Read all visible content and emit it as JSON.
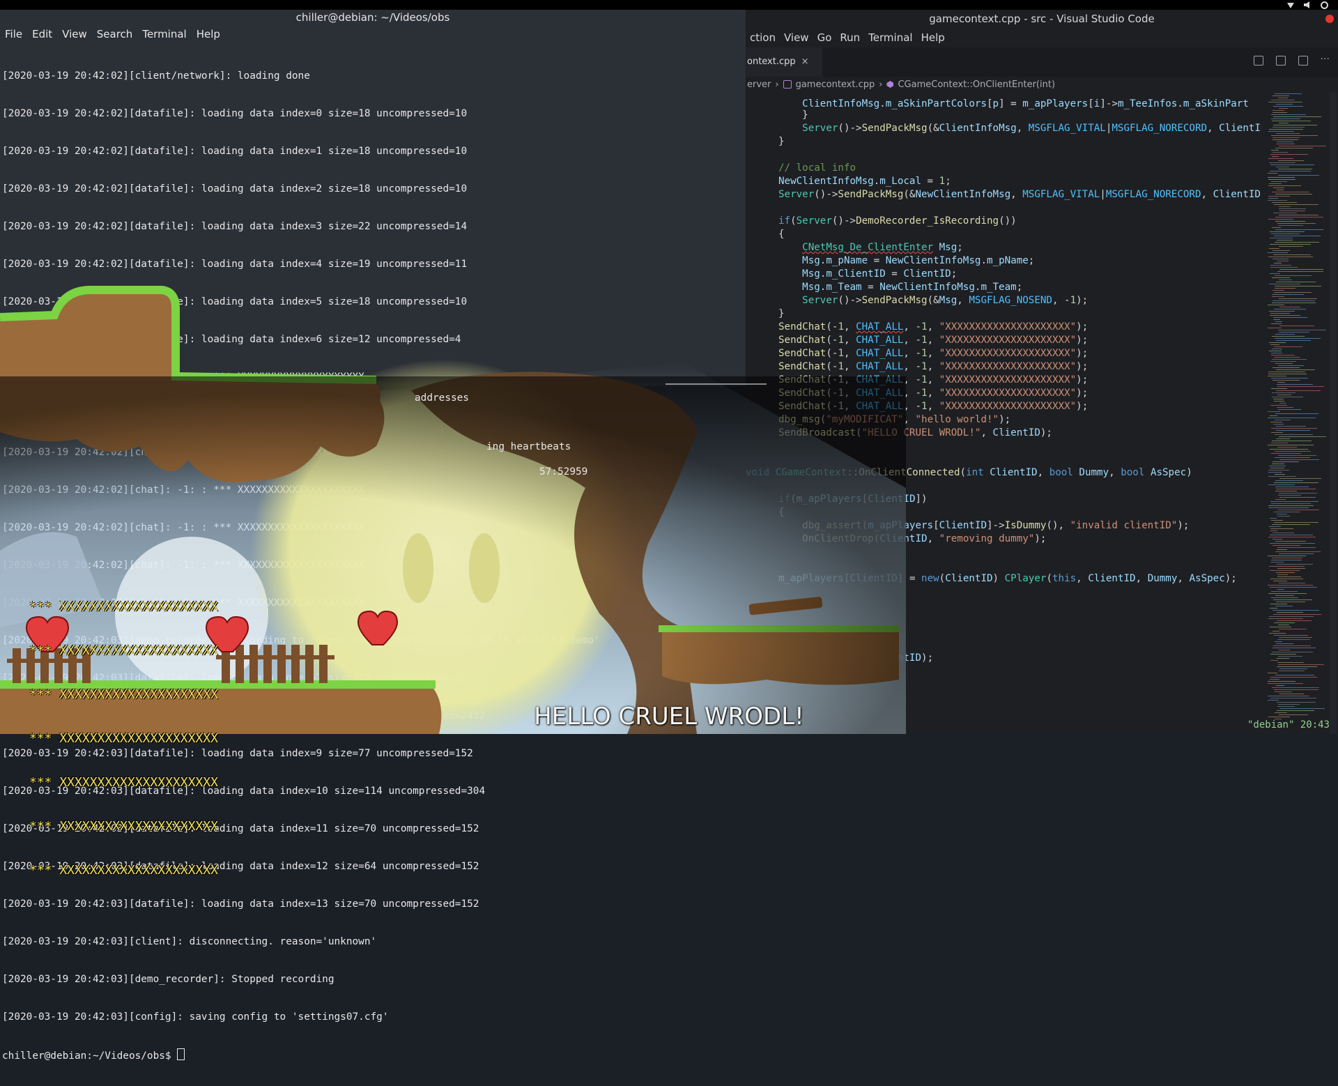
{
  "topbar": {
    "icons": [
      "wifi-icon",
      "volume-icon",
      "power-icon"
    ]
  },
  "terminal": {
    "title": "chiller@debian: ~/Videos/obs",
    "menu": [
      "File",
      "Edit",
      "View",
      "Search",
      "Terminal",
      "Help"
    ],
    "lines": [
      "[2020-03-19 20:42:02][client/network]: loading done",
      "[2020-03-19 20:42:02][datafile]: loading data index=0 size=18 uncompressed=10",
      "[2020-03-19 20:42:02][datafile]: loading data index=1 size=18 uncompressed=10",
      "[2020-03-19 20:42:02][datafile]: loading data index=2 size=18 uncompressed=10",
      "[2020-03-19 20:42:02][datafile]: loading data index=3 size=22 uncompressed=14",
      "[2020-03-19 20:42:02][datafile]: loading data index=4 size=19 uncompressed=11",
      "[2020-03-19 20:42:02][datafile]: loading data index=5 size=18 uncompressed=10",
      "[2020-03-19 20:42:02][datafile]: loading data index=6 size=12 uncompressed=4",
      "[2020-03-19 20:42:02][chat]: -1: : *** XXXXXXXXXXXXXXXXXXXXX",
      "[2020-03-19 20:42:02][chat]: -1: : *** XXXXXXXXXXXXXXXXXXXXX",
      "[2020-03-19 20:42:02][chat]: -1: : *** XXXXXXXXXXXXXXXXXXXXX",
      "[2020-03-19 20:42:02][chat]: -1: : *** XXXXXXXXXXXXXXXXXXXXX",
      "[2020-03-19 20:42:02][chat]: -1: : *** XXXXXXXXXXXXXXXXXXXXX",
      "[2020-03-19 20:42:02][chat]: -1: : *** XXXXXXXXXXXXXXXXXXXXX",
      "[2020-03-19 20:42:02][chat]: -1: : *** XXXXXXXXXXXXXXXXXXXXX",
      "[2020-03-19 20:42:03][demo_recorder]: Recording to 'demos/auto/autorecord_2020-03-19_20-42-03.demo'",
      "[2020-03-19 20:42:03][datafile]: loading data index=7 size=74 uncompressed=152",
      "[2020-03-19 20:42:03][datafile]: loading data index=8 size=627 uncompressed=2432",
      "[2020-03-19 20:42:03][datafile]: loading data index=9 size=77 uncompressed=152",
      "[2020-03-19 20:42:03][datafile]: loading data index=10 size=114 uncompressed=304",
      "[2020-03-19 20:42:03][datafile]: loading data index=11 size=70 uncompressed=152",
      "[2020-03-19 20:42:03][datafile]: loading data index=12 size=64 uncompressed=152",
      "[2020-03-19 20:42:03][datafile]: loading data index=13 size=70 uncompressed=152",
      "[2020-03-19 20:42:03][client]: disconnecting. reason='unknown'",
      "[2020-03-19 20:42:03][demo_recorder]: Stopped recording",
      "[2020-03-19 20:42:03][config]: saving config to 'settings07.cfg'",
      "chiller@debian:~/Videos/obs$ "
    ],
    "background_fragments": [
      "addresses",
      "ing heartbeats",
      "57:52959"
    ]
  },
  "vscode": {
    "title": "gamecontext.cpp - src - Visual Studio Code",
    "menu": [
      "ction",
      "View",
      "Go",
      "Run",
      "Terminal",
      "Help"
    ],
    "tab": {
      "label": "ontext.cpp",
      "close": "×"
    },
    "breadcrumbs": [
      "erver",
      "›",
      "gamecontext.cpp",
      "›",
      "CGameContext::OnClientEnter(int)"
    ],
    "status": "\"debian\" 20:43"
  },
  "game": {
    "broadcast": "HELLO CRUEL WRODL!",
    "chat_lines": [
      "*** XXXXXXXXXXXXXXXXXXXXX",
      "*** XXXXXXXXXXXXXXXXXXXXX",
      "*** XXXXXXXXXXXXXXXXXXXXX",
      "*** XXXXXXXXXXXXXXXXXXXXX",
      "*** XXXXXXXXXXXXXXXXXXXXX",
      "*** XXXXXXXXXXXXXXXXXXXXX",
      "*** XXXXXXXXXXXXXXXXXXXXX"
    ]
  }
}
